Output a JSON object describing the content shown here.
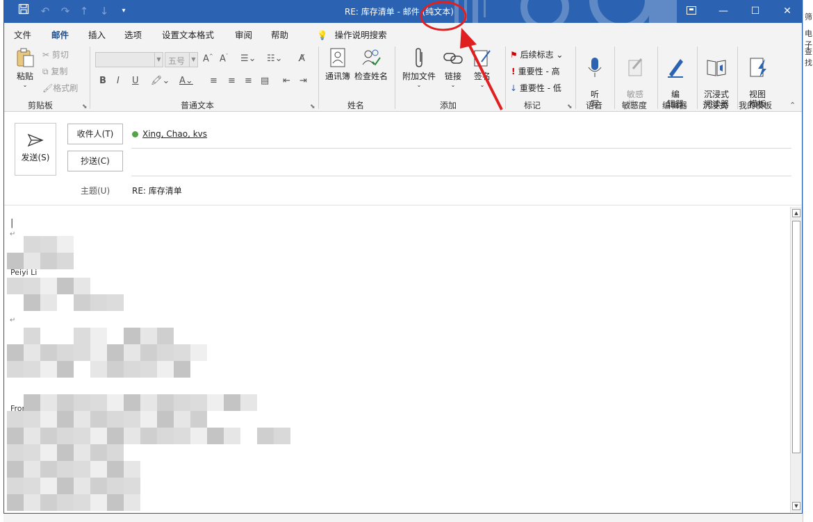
{
  "title_bar": {
    "title": "RE: 库存清单  -  邮件 (纯文本)"
  },
  "menu": {
    "tabs": [
      "文件",
      "邮件",
      "插入",
      "选项",
      "设置文本格式",
      "审阅",
      "帮助",
      "操作说明搜索"
    ]
  },
  "ribbon": {
    "clipboard": {
      "paste": "粘贴",
      "cut": "剪切",
      "copy": "复制",
      "format_painter": "格式刷",
      "label": "剪贴板"
    },
    "basic_text": {
      "font_size": "五号",
      "label": "普通文本"
    },
    "names": {
      "address_book": "通讯簿",
      "check_names": "检查姓名",
      "label": "姓名"
    },
    "include": {
      "attach_file": "附加文件",
      "link": "链接",
      "signature": "签名",
      "label": "添加"
    },
    "tags": {
      "follow_up": "后续标志",
      "high": "重要性 - 高",
      "low": "重要性 - 低",
      "label": "标记"
    },
    "voice": {
      "dictate": "听\n写",
      "label": "语音"
    },
    "sensitivity": {
      "button": "敏感\n性",
      "label": "敏感度"
    },
    "editor": {
      "button": "编\n辑器",
      "label": "编辑器"
    },
    "immersive": {
      "button": "沉浸式\n阅读器",
      "label": "沉浸式"
    },
    "templates": {
      "button": "视图\n模板",
      "label": "我的模板"
    }
  },
  "header": {
    "send": "发送(S)",
    "to_button": "收件人(T)",
    "cc_button": "抄送(C)",
    "recipient": "Xing, Chao, kvs",
    "subject_label": "主题(U)",
    "subject_value": "RE: 库存清单"
  },
  "body": {
    "line1": "Peiyi Li",
    "line2": "From: Y",
    "line3": "主任"
  },
  "behind_window": {
    "t1": "筛",
    "t2": "电子",
    "t3": "查找"
  },
  "colors": {
    "titlebar": "#2b63b2",
    "annotation": "#e02020"
  }
}
